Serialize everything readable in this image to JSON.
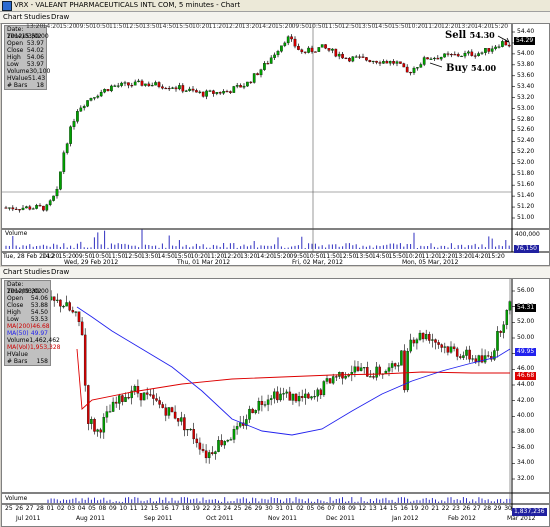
{
  "window": {
    "title": "VRX - VALEANT PHARMACEUTICALS INTL COM, 5 minutes - Chart"
  },
  "top": {
    "menu": [
      "Chart",
      "Studies",
      "Draw"
    ],
    "info_title": "Date: 2012/03/02",
    "info_rows": [
      [
        "Time",
        "15:50:00"
      ],
      [
        "Open",
        "53.97"
      ],
      [
        "Close",
        "54.02"
      ],
      [
        "High",
        "54.06"
      ],
      [
        "Low",
        "53.97"
      ],
      [
        "Volume",
        "30,100"
      ],
      [
        "HValue",
        "51.43"
      ],
      [
        "# Bars",
        "18"
      ]
    ],
    "price_ticks": [
      "54.40",
      "54.20",
      "54.00",
      "53.80",
      "53.60",
      "53.40",
      "53.20",
      "53.00",
      "52.80",
      "52.60",
      "52.40",
      "52.20",
      "52.00",
      "51.80",
      "51.60",
      "51.40",
      "51.20",
      "51.00"
    ],
    "last_price": "54.29",
    "volume_label": "Volume",
    "volume_ticks": [
      "400,000",
      "76,150"
    ],
    "time_ticks": [
      "Tue, 28 Feb 2012",
      "14:20",
      "15:20",
      "09:50",
      "10:50",
      "11:50",
      "12:50",
      "13:50",
      "14:50",
      "15:50",
      "10:20",
      "11:20",
      "12:20",
      "13:20",
      "14:20",
      "15:20",
      "09:50",
      "10:50",
      "11:50",
      "12:50",
      "13:50",
      "14:50",
      "15:50",
      "10:20",
      "11:20",
      "12:20",
      "13:20",
      "14:20",
      "15:20"
    ],
    "day_labels": [
      "Wed, 29 Feb 2012",
      "Thu, 01 Mar 2012",
      "Fri, 02 Mar, 2012",
      "Mon, 05 Mar, 2012"
    ],
    "top_time_ticks": [
      "13:20",
      "14:20",
      "15:20",
      "09:50",
      "10:50",
      "11:50",
      "12:50",
      "13:50",
      "14:50",
      "15:50",
      "10:20",
      "11:20",
      "12:20",
      "13:20",
      "14:20",
      "15:20",
      "09:50",
      "10:50",
      "11:50",
      "12:50",
      "13:50",
      "14:50",
      "15:50",
      "10:20",
      "11:20",
      "12:20",
      "13:20",
      "14:20",
      "15:20"
    ],
    "annotations": {
      "sell": "Sell",
      "sell_price": "54.30",
      "buy": "Buy",
      "buy_price": "54.00"
    }
  },
  "bottom": {
    "menu": [
      "Chart",
      "Studies",
      "Draw"
    ],
    "info_title": "Date: 2012/03/02",
    "info_rows": [
      [
        "Time",
        "09:30:00"
      ],
      [
        "Open",
        "54.06"
      ],
      [
        "Close",
        "53.88"
      ],
      [
        "High",
        "54.50"
      ],
      [
        "Low",
        "53.53"
      ],
      [
        "MA(200)",
        "46.68"
      ],
      [
        "MA(50)",
        "49.97"
      ],
      [
        "Volume",
        "1,462,462"
      ],
      [
        "MA(Vol)",
        "1,953,328"
      ],
      [
        "HValue",
        ""
      ],
      [
        "# Bars",
        "158"
      ]
    ],
    "price_ticks": [
      "56.00",
      "54.00",
      "52.00",
      "50.00",
      "48.00",
      "46.00",
      "44.00",
      "42.00",
      "40.00",
      "38.00",
      "36.00",
      "34.00",
      "32.00"
    ],
    "last_price": "54.31",
    "ma50_value": "49.95",
    "ma200_value": "46.68",
    "volume_label": "Volume",
    "volume_value": "1,837,236",
    "date_ticks": [
      "25",
      "26",
      "27",
      "28",
      "01",
      "02",
      "03",
      "04",
      "05",
      "08",
      "09",
      "10",
      "11",
      "12",
      "15",
      "16",
      "17",
      "18",
      "19",
      "22",
      "23",
      "24",
      "25",
      "26",
      "29",
      "30",
      "31",
      "01",
      "02",
      "05",
      "06",
      "07",
      "08",
      "09",
      "12",
      "13",
      "14",
      "15",
      "16",
      "19",
      "20",
      "21",
      "22",
      "23",
      "26",
      "27",
      "28",
      "29",
      "30"
    ],
    "month_labels": [
      "Jul 2011",
      "Aug 2011",
      "Sep 2011",
      "Oct 2011",
      "Nov 2011",
      "Dec 2011",
      "Jan 2012",
      "Feb 2012",
      "Mar 2012"
    ]
  },
  "colors": {
    "up": "#00a000",
    "down": "#d00000",
    "ma50": "#2222ee",
    "ma200": "#dd0000",
    "volume": "#3030c0"
  }
}
